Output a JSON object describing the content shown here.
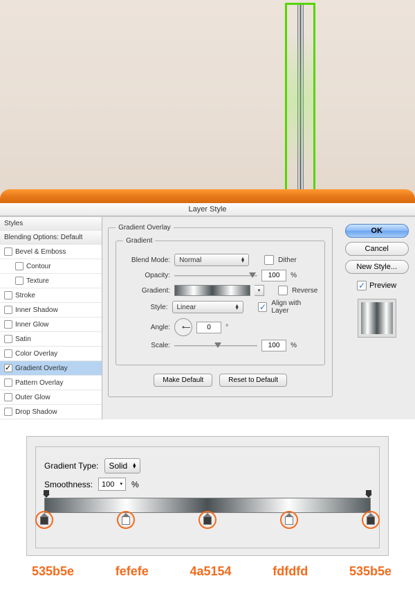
{
  "dialog_title": "Layer Style",
  "sidebar": {
    "styles_header": "Styles",
    "blending_header": "Blending Options: Default",
    "items": [
      {
        "label": "Bevel & Emboss",
        "checked": false,
        "name": "bevel-emboss"
      },
      {
        "label": "Contour",
        "checked": false,
        "sub": true,
        "name": "contour"
      },
      {
        "label": "Texture",
        "checked": false,
        "sub": true,
        "name": "texture"
      },
      {
        "label": "Stroke",
        "checked": false,
        "name": "stroke"
      },
      {
        "label": "Inner Shadow",
        "checked": false,
        "name": "inner-shadow"
      },
      {
        "label": "Inner Glow",
        "checked": false,
        "name": "inner-glow"
      },
      {
        "label": "Satin",
        "checked": false,
        "name": "satin"
      },
      {
        "label": "Color Overlay",
        "checked": false,
        "name": "color-overlay"
      },
      {
        "label": "Gradient Overlay",
        "checked": true,
        "selected": true,
        "name": "gradient-overlay"
      },
      {
        "label": "Pattern Overlay",
        "checked": false,
        "name": "pattern-overlay"
      },
      {
        "label": "Outer Glow",
        "checked": false,
        "name": "outer-glow"
      },
      {
        "label": "Drop Shadow",
        "checked": false,
        "name": "drop-shadow"
      }
    ]
  },
  "main": {
    "group_title": "Gradient Overlay",
    "inner_title": "Gradient",
    "blend_mode_label": "Blend Mode:",
    "blend_mode_value": "Normal",
    "dither_label": "Dither",
    "dither_checked": false,
    "opacity_label": "Opacity:",
    "opacity_value": "100",
    "percent": "%",
    "gradient_label": "Gradient:",
    "reverse_label": "Reverse",
    "reverse_checked": false,
    "style_label": "Style:",
    "style_value": "Linear",
    "align_label": "Align with Layer",
    "align_checked": true,
    "angle_label": "Angle:",
    "angle_value": "0",
    "degree": "°",
    "scale_label": "Scale:",
    "scale_value": "100",
    "make_default": "Make Default",
    "reset_default": "Reset to Default"
  },
  "right": {
    "ok": "OK",
    "cancel": "Cancel",
    "new_style": "New Style...",
    "preview": "Preview",
    "preview_checked": true
  },
  "editor": {
    "type_label": "Gradient Type:",
    "type_value": "Solid",
    "smooth_label": "Smoothness:",
    "smooth_value": "100",
    "percent": "%",
    "stops": [
      {
        "hex": "535b5e",
        "pos": 0,
        "dark": true
      },
      {
        "hex": "fefefe",
        "pos": 25,
        "dark": false
      },
      {
        "hex": "4a5154",
        "pos": 50,
        "dark": true
      },
      {
        "hex": "fdfdfd",
        "pos": 75,
        "dark": false
      },
      {
        "hex": "535b5e",
        "pos": 100,
        "dark": true
      }
    ]
  }
}
